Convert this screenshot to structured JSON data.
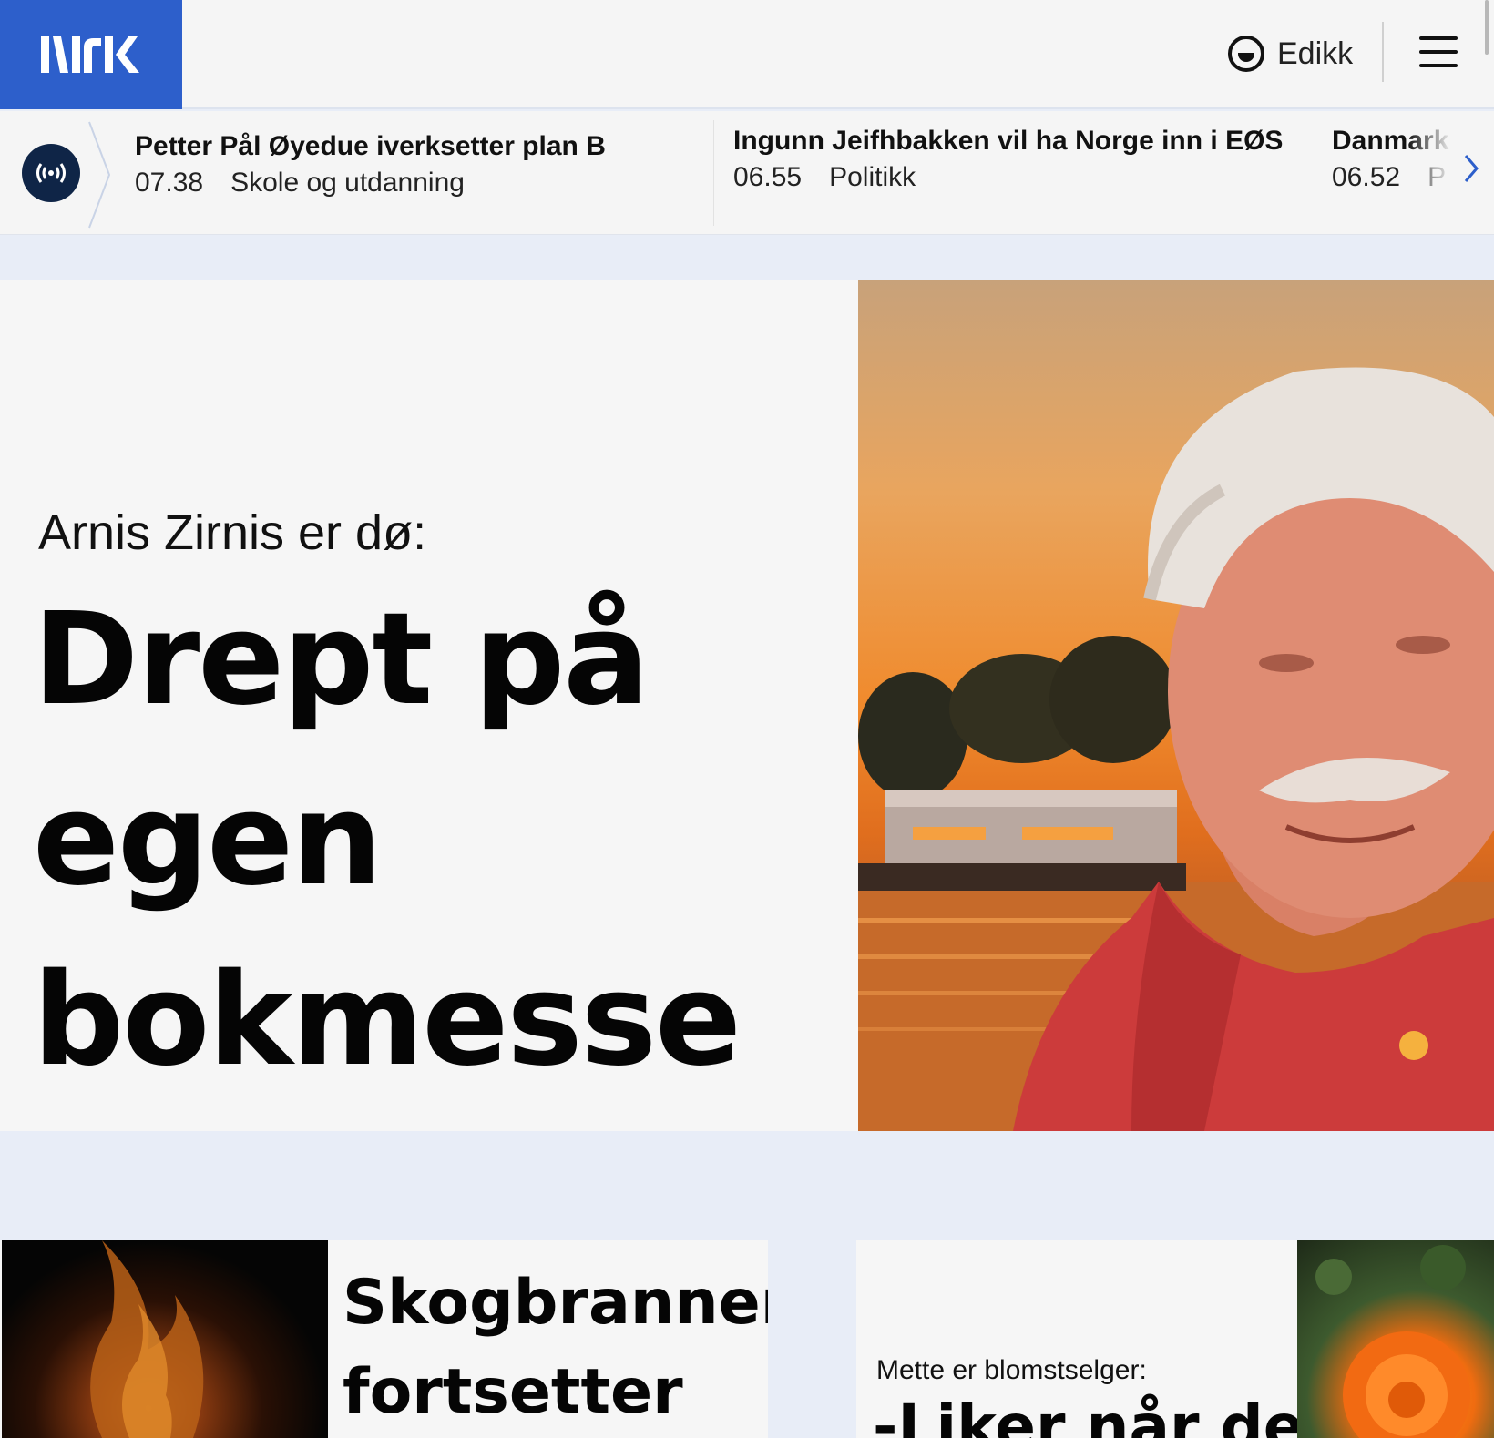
{
  "header": {
    "logo": "NRK",
    "user_name": "Edikk",
    "menu_label": "Meny"
  },
  "ticker": {
    "items": [
      {
        "title": "Petter Pål Øyedue iverksetter plan B",
        "time": "07.38",
        "category": "Skole og utdanning"
      },
      {
        "title": "Ingunn Jeifhbakken vil ha Norge inn i EØS",
        "time": "06.55",
        "category": "Politikk"
      },
      {
        "title": "Danmark",
        "time": "06.52",
        "category": "P"
      }
    ]
  },
  "hero": {
    "kicker": "Arnis Zirnis er dø:",
    "title": "Drept på egen bokmesse"
  },
  "cards": [
    {
      "kicker": "",
      "title": "Skogbranner fortsetter"
    },
    {
      "kicker": "Mette er blomstselger:",
      "title": "-Liker når de"
    }
  ],
  "colors": {
    "brand": "#2d5fcb",
    "live_icon_bg": "#0f2547",
    "page_bg": "#e8edf7"
  },
  "icons": {
    "live": "live-broadcast-icon",
    "user": "user-avatar-icon",
    "menu": "hamburger-menu-icon",
    "next": "chevron-right-icon"
  }
}
